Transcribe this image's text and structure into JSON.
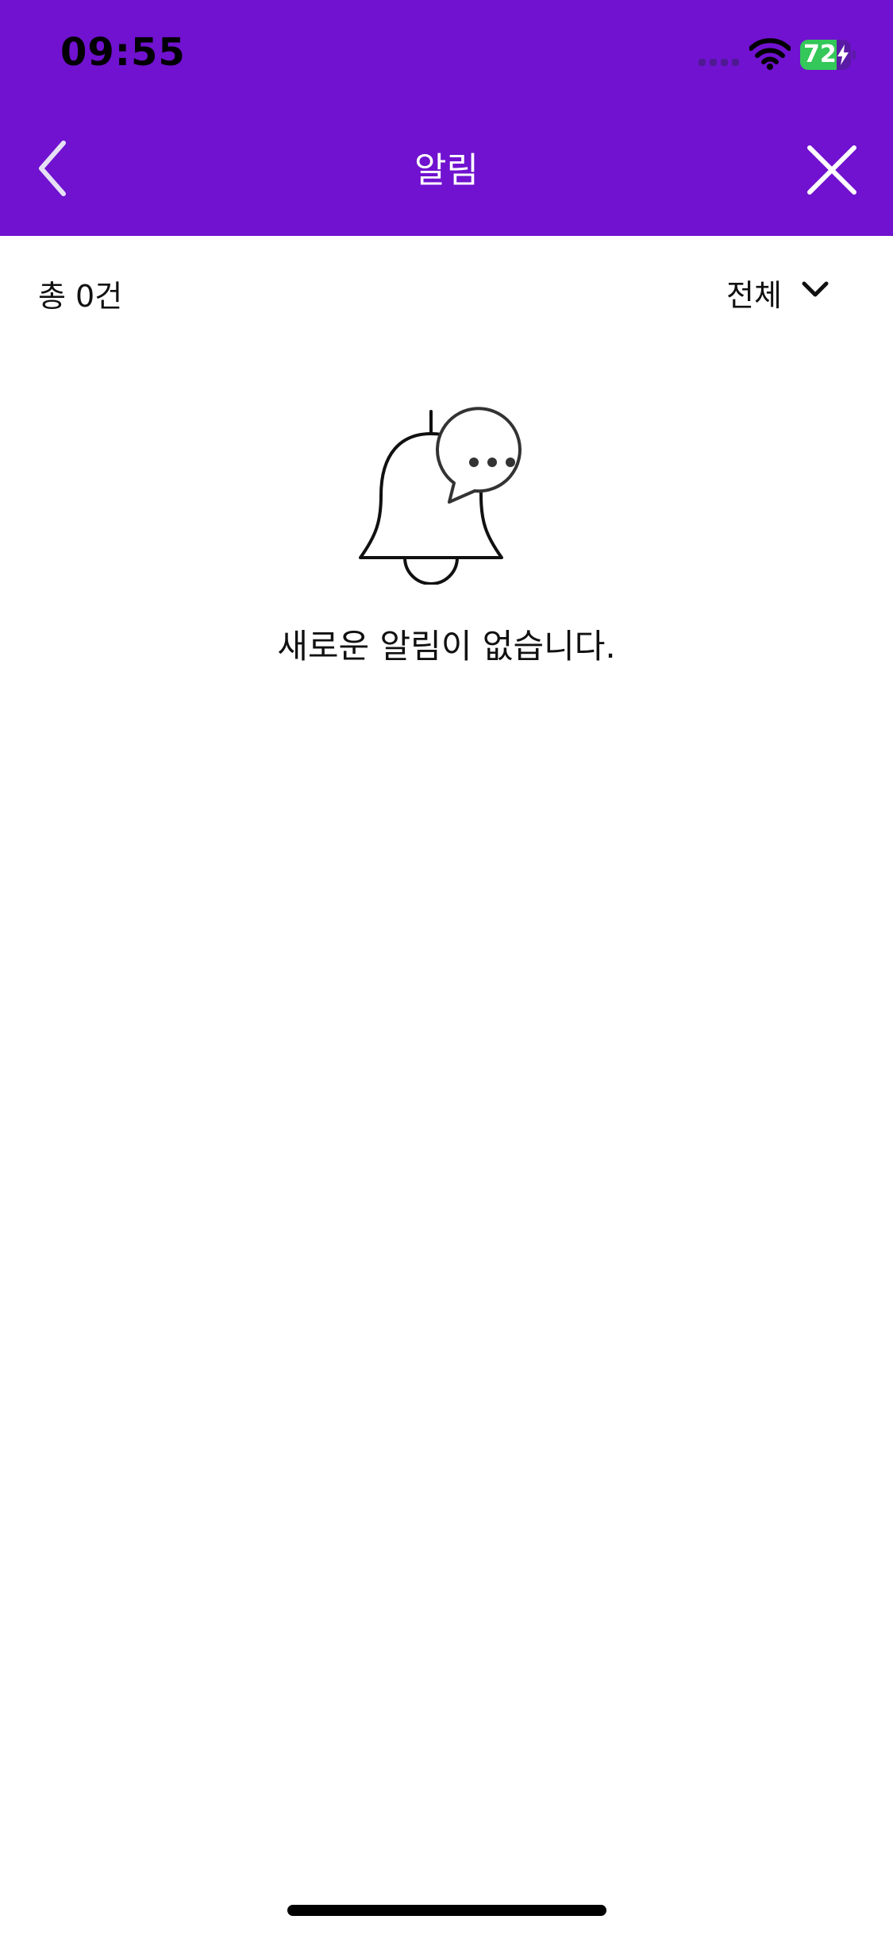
{
  "status_bar": {
    "time": "09:55",
    "battery_level": "72",
    "battery_fraction": 0.72
  },
  "header": {
    "title": "알림",
    "background_color": "#7012CF",
    "back_icon": "chevron-left-icon",
    "close_icon": "close-icon"
  },
  "filter": {
    "total_label": "총 0건",
    "selected_option": "전체",
    "dropdown_icon": "chevron-down-icon"
  },
  "empty_state": {
    "icon": "bell-chat-icon",
    "message": "새로운 알림이 없습니다."
  }
}
